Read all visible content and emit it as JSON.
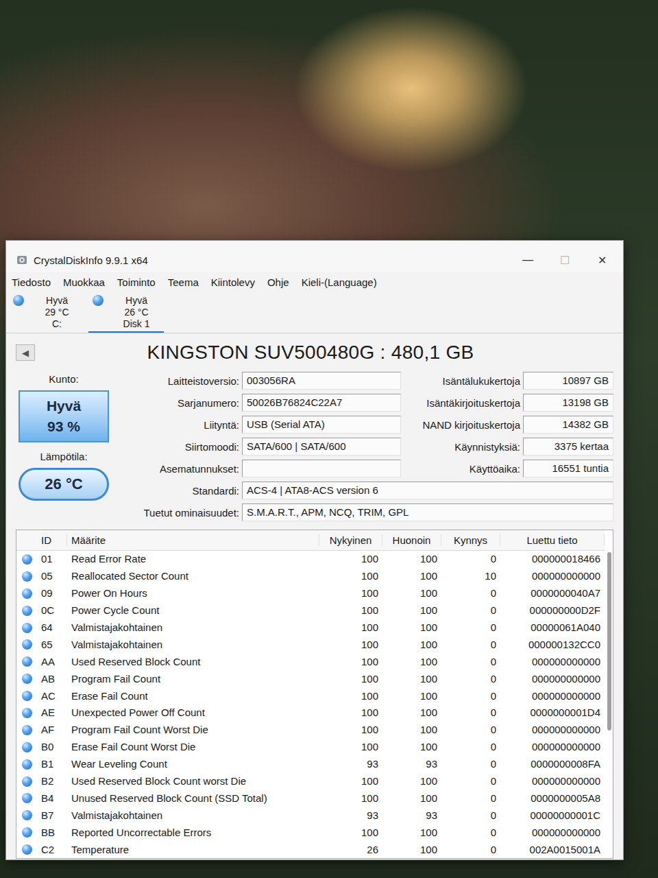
{
  "window": {
    "title": "CrystalDiskInfo 9.9.1 x64",
    "controls": [
      "—",
      "☐",
      "✕"
    ]
  },
  "menu": [
    "Tiedosto",
    "Muokkaa",
    "Toiminto",
    "Teema",
    "Kiintolevy",
    "Ohje",
    "Kieli-(Language)"
  ],
  "disks": [
    {
      "status": "Hyvä",
      "temperature": "29 °C",
      "label": "C:",
      "selected": false
    },
    {
      "status": "Hyvä",
      "temperature": "26 °C",
      "label": "Disk 1",
      "selected": true
    }
  ],
  "drive": {
    "nav": "◀",
    "title": "KINGSTON SUV500480G : 480,1 GB"
  },
  "health": {
    "label": "Kunto:",
    "status": "Hyvä",
    "percent": "93 %"
  },
  "temperature": {
    "label": "Lämpötila:",
    "value": "26 °C"
  },
  "info_left": [
    {
      "label": "Laitteistoversio:",
      "value": "003056RA"
    },
    {
      "label": "Sarjanumero:",
      "value": "50026B76824C22A7"
    },
    {
      "label": "Liityntä:",
      "value": "USB (Serial ATA)"
    },
    {
      "label": "Siirtomoodi:",
      "value": "SATA/600 | SATA/600"
    },
    {
      "label": "Asematunnukset:",
      "value": ""
    },
    {
      "label": "Standardi:",
      "value": "ACS-4 | ATA8-ACS version 6"
    },
    {
      "label": "Tuetut ominaisuudet:",
      "value": "S.M.A.R.T., APM, NCQ, TRIM, GPL"
    }
  ],
  "info_right": [
    {
      "label": "Isäntälukukertoja",
      "value": "10897 GB"
    },
    {
      "label": "Isäntäkirjoituskertoja",
      "value": "13198 GB"
    },
    {
      "label": "NAND kirjoituskertoja",
      "value": "14382 GB"
    },
    {
      "label": "Käynnistyksiä:",
      "value": "3375 kertaa"
    },
    {
      "label": "Käyttöaika:",
      "value": "16551 tuntia"
    }
  ],
  "table": {
    "columns": [
      "ID",
      "Määrite",
      "Nykyinen",
      "Huonoin",
      "Kynnys",
      "Luettu tieto"
    ],
    "rows": [
      {
        "id": "01",
        "name": "Read Error Rate",
        "current": "100",
        "worst": "100",
        "threshold": "0",
        "raw": "000000018466"
      },
      {
        "id": "05",
        "name": "Reallocated Sector Count",
        "current": "100",
        "worst": "100",
        "threshold": "10",
        "raw": "000000000000"
      },
      {
        "id": "09",
        "name": "Power On Hours",
        "current": "100",
        "worst": "100",
        "threshold": "0",
        "raw": "0000000040A7"
      },
      {
        "id": "0C",
        "name": "Power Cycle Count",
        "current": "100",
        "worst": "100",
        "threshold": "0",
        "raw": "000000000D2F"
      },
      {
        "id": "64",
        "name": "Valmistajakohtainen",
        "current": "100",
        "worst": "100",
        "threshold": "0",
        "raw": "00000061A040"
      },
      {
        "id": "65",
        "name": "Valmistajakohtainen",
        "current": "100",
        "worst": "100",
        "threshold": "0",
        "raw": "000000132CC0"
      },
      {
        "id": "AA",
        "name": "Used Reserved Block Count",
        "current": "100",
        "worst": "100",
        "threshold": "0",
        "raw": "000000000000"
      },
      {
        "id": "AB",
        "name": "Program Fail Count",
        "current": "100",
        "worst": "100",
        "threshold": "0",
        "raw": "000000000000"
      },
      {
        "id": "AC",
        "name": "Erase Fail Count",
        "current": "100",
        "worst": "100",
        "threshold": "0",
        "raw": "000000000000"
      },
      {
        "id": "AE",
        "name": "Unexpected Power Off Count",
        "current": "100",
        "worst": "100",
        "threshold": "0",
        "raw": "0000000001D4"
      },
      {
        "id": "AF",
        "name": "Program Fail Count Worst Die",
        "current": "100",
        "worst": "100",
        "threshold": "0",
        "raw": "000000000000"
      },
      {
        "id": "B0",
        "name": "Erase Fail Count Worst Die",
        "current": "100",
        "worst": "100",
        "threshold": "0",
        "raw": "000000000000"
      },
      {
        "id": "B1",
        "name": "Wear Leveling Count",
        "current": "93",
        "worst": "93",
        "threshold": "0",
        "raw": "0000000008FA"
      },
      {
        "id": "B2",
        "name": "Used Reserved Block Count worst Die",
        "current": "100",
        "worst": "100",
        "threshold": "0",
        "raw": "000000000000"
      },
      {
        "id": "B4",
        "name": "Unused Reserved Block Count (SSD Total)",
        "current": "100",
        "worst": "100",
        "threshold": "0",
        "raw": "0000000005A8"
      },
      {
        "id": "B7",
        "name": "Valmistajakohtainen",
        "current": "93",
        "worst": "93",
        "threshold": "0",
        "raw": "00000000001C"
      },
      {
        "id": "BB",
        "name": "Reported Uncorrectable Errors",
        "current": "100",
        "worst": "100",
        "threshold": "0",
        "raw": "000000000000"
      },
      {
        "id": "C2",
        "name": "Temperature",
        "current": "26",
        "worst": "100",
        "threshold": "0",
        "raw": "002A0015001A"
      }
    ]
  }
}
